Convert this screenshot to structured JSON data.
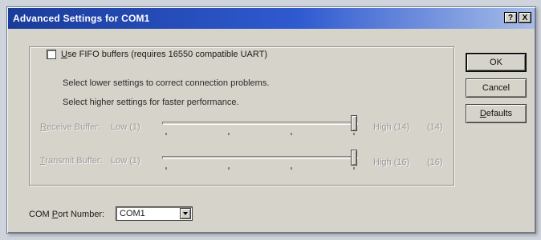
{
  "window": {
    "title": "Advanced Settings for COM1",
    "help_glyph": "?",
    "close_glyph": "X"
  },
  "fifo": {
    "label_u": "U",
    "label_rest": "se FIFO buffers (requires 16550 compatible UART)",
    "checked": false
  },
  "info": {
    "line1": "Select lower settings to correct connection problems.",
    "line2": "Select higher settings for faster performance."
  },
  "receive_buffer": {
    "label_u": "R",
    "label_rest": "eceive Buffer:",
    "low": "Low (1)",
    "high": "High (14)",
    "value": "(14)",
    "level_fraction": 1.0,
    "enabled": false
  },
  "transmit_buffer": {
    "label_u": "T",
    "label_rest": "ransmit Buffer:",
    "low": "Low (1)",
    "high": "High (16)",
    "value": "(16)",
    "level_fraction": 1.0,
    "enabled": false
  },
  "buttons": {
    "ok": "OK",
    "cancel": "Cancel",
    "defaults_u": "D",
    "defaults_rest": "efaults"
  },
  "com_port": {
    "label_pre": "COM ",
    "label_u": "P",
    "label_rest": "ort Number:",
    "value": "COM1"
  },
  "colors": {
    "titlebar_start": "#1a3c9a",
    "titlebar_end": "#a7bde8",
    "dialog_bg": "#d6d3ca"
  }
}
